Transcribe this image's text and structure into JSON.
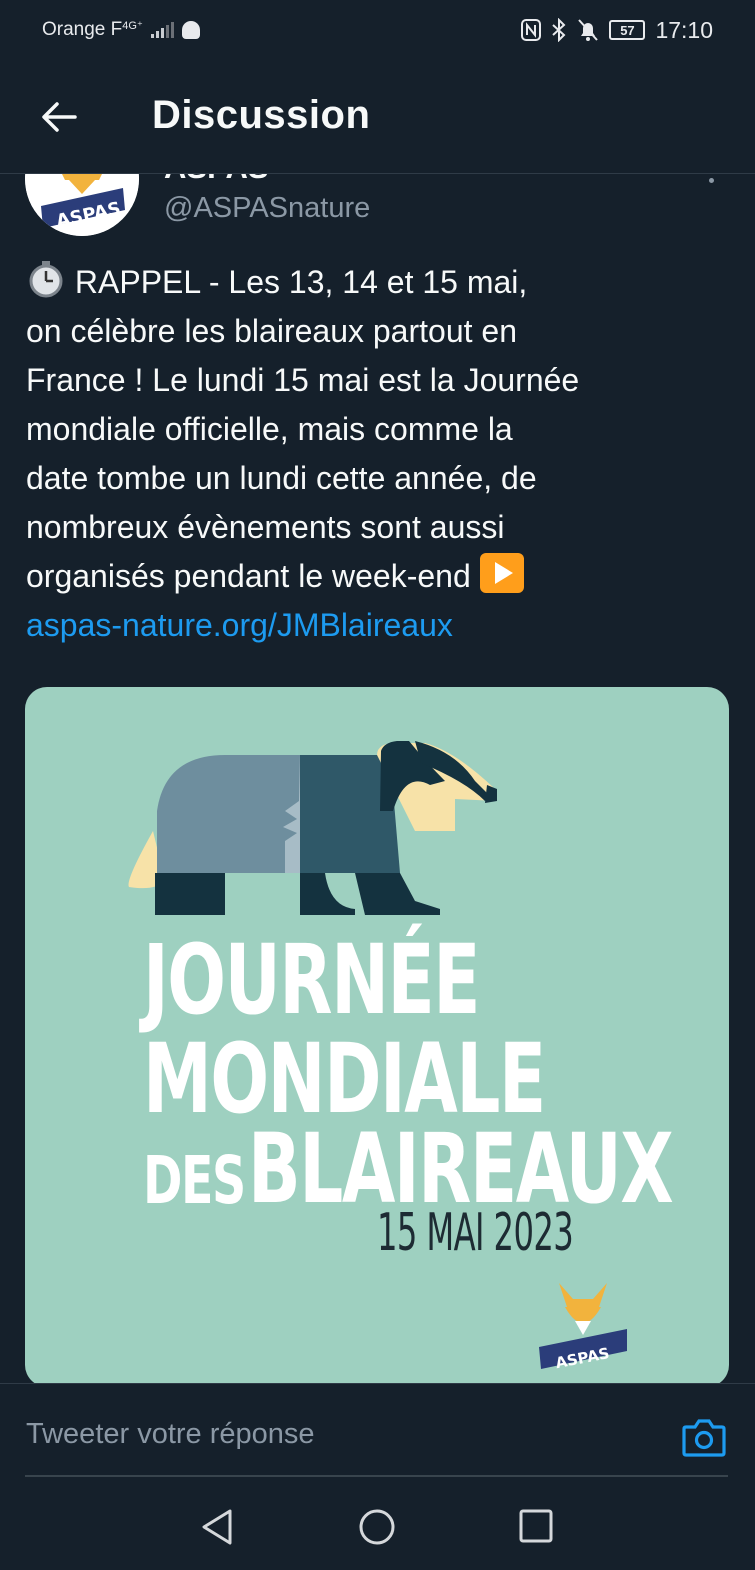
{
  "status_bar": {
    "carrier": "Orange F",
    "network": "4G⁺",
    "time": "17:10",
    "battery": "57"
  },
  "header": {
    "title": "Discussion"
  },
  "tweet": {
    "author_name": "ASPAS",
    "author_handle": "@ASPASnature",
    "avatar_label": "ASPAS",
    "text_lines": [
      "RAPPEL - Les 13, 14 et 15 mai,",
      "on célèbre les blaireaux partout en",
      "France ! Le lundi 15 mai est la Journée",
      "mondiale officielle, mais comme la",
      "date tombe un lundi cette année, de",
      "nombreux évènements sont aussi",
      "organisés pendant le week-end"
    ],
    "link": "aspas-nature.org/JMBlaireaux",
    "media": {
      "line1": "JOURNÉE",
      "line2": "MONDIALE",
      "line3_prefix": "DES",
      "line3": "BLAIREAUX",
      "date": "15 MAI 2023",
      "logo_text": "ASPAS",
      "background_color": "#9ed0c0"
    }
  },
  "reply": {
    "placeholder": "Tweeter votre réponse"
  },
  "colors": {
    "background": "#15202b",
    "link": "#1d9bf0",
    "muted": "#8b98a5"
  }
}
